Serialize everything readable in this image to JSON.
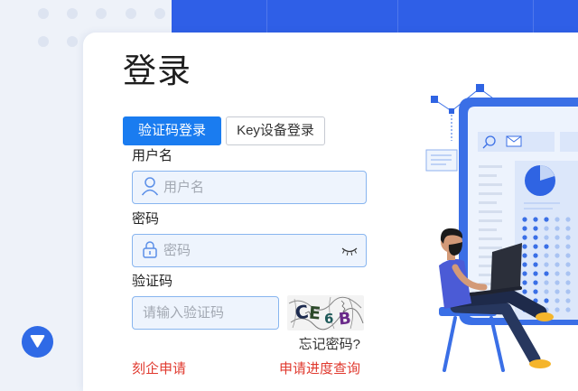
{
  "login": {
    "title": "登录",
    "tabs": [
      {
        "label": "验证码登录",
        "active": true
      },
      {
        "label": "Key设备登录",
        "active": false
      }
    ],
    "username": {
      "label": "用户名",
      "placeholder": "用户名",
      "icon": "user-icon"
    },
    "password": {
      "label": "密码",
      "placeholder": "密码",
      "icon": "lock-icon",
      "toggle_icon": "eye-closed-icon"
    },
    "captcha": {
      "label": "验证码",
      "placeholder": "请输入验证码",
      "image_chars": [
        "C",
        "E",
        "6",
        "B"
      ]
    },
    "forgot_password": "忘记密码?",
    "apply_link": "刻企申请",
    "progress_link": "申请进度查询"
  },
  "scroll_button": {
    "icon": "arrow-down-icon"
  },
  "colors": {
    "primary": "#1a7cf0",
    "header_band": "#2f5fe7",
    "link_red": "#e03a2f",
    "input_bg": "#eef4fd",
    "input_border": "#88b5ef",
    "page_bg": "#eef2f9"
  }
}
